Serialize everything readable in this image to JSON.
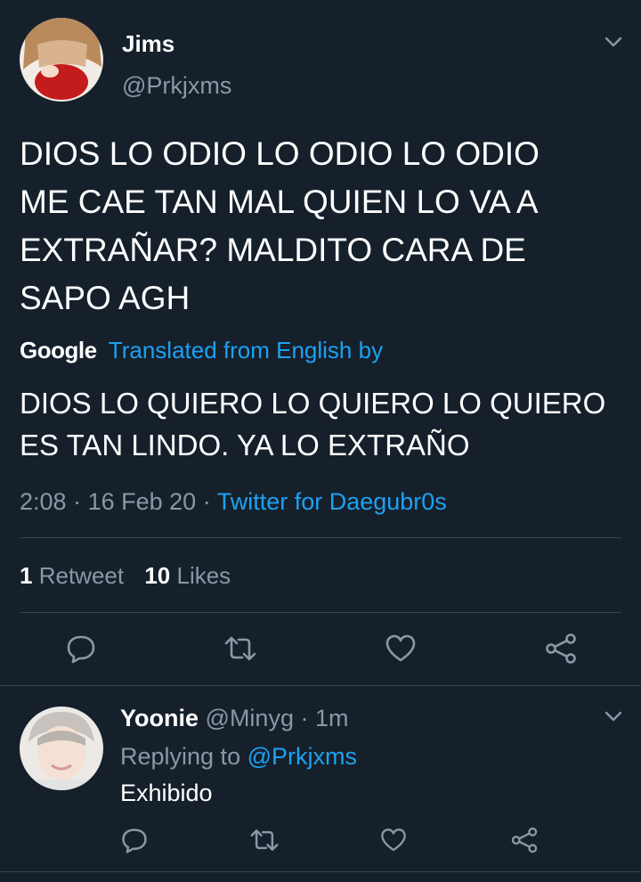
{
  "tweet": {
    "author_name": "Jims",
    "author_handle": "@Prkjxms",
    "text_lines": [
      "DIOS LO ODIO LO ODIO LO ODIO",
      "ME CAE TAN MAL QUIEN LO VA A",
      "EXTRAÑAR? MALDITO CARA DE",
      "SAPO AGH"
    ],
    "translation_brand": "Google",
    "translation_label": "Translated from English by",
    "original_lines": [
      "DIOS LO QUIERO LO QUIERO LO QUIERO",
      "ES TAN LINDO. YA LO EXTRAÑO"
    ],
    "time": "2:08",
    "date": "16 Feb 20",
    "source": "Twitter for Daegubr0s",
    "retweet_count": "1",
    "retweet_label": "Retweet",
    "like_count": "10",
    "like_label": "Likes"
  },
  "reply": {
    "author_name": "Yoonie",
    "author_handle": "@Minyg",
    "age": "1m",
    "replying_prefix": "Replying to",
    "replying_handle": "@Prkjxms",
    "text": "Exhibido"
  },
  "colors": {
    "background": "#15202b",
    "secondary_text": "#8899a6",
    "accent": "#1da1f2",
    "divider": "#38444d"
  },
  "icons": [
    "chevron-down-icon",
    "reply-icon",
    "retweet-icon",
    "like-icon",
    "share-icon"
  ]
}
